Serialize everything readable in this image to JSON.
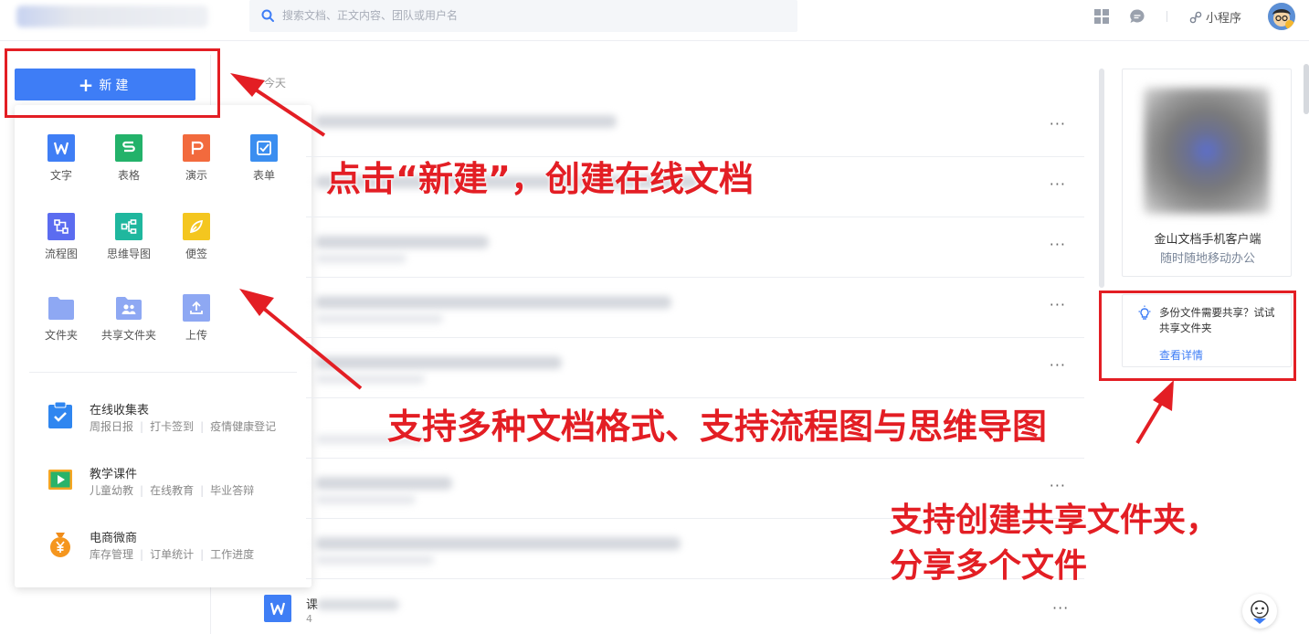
{
  "topbar": {
    "search_placeholder": "搜索文档、正文内容、团队或用户名",
    "mini_program": "小程序"
  },
  "new_button": {
    "plus": "+",
    "label": "新建"
  },
  "create_menu": {
    "types": [
      {
        "label": "文字",
        "color": "#3f7ef5",
        "icon": "word-doc-icon"
      },
      {
        "label": "表格",
        "color": "#23b26a",
        "icon": "spreadsheet-icon"
      },
      {
        "label": "演示",
        "color": "#f26a3d",
        "icon": "presentation-icon"
      },
      {
        "label": "表单",
        "color": "#3b8ef0",
        "icon": "form-icon"
      },
      {
        "label": "流程图",
        "color": "#5b6cf0",
        "icon": "flowchart-icon"
      },
      {
        "label": "思维导图",
        "color": "#1fb79e",
        "icon": "mindmap-icon"
      },
      {
        "label": "便签",
        "color": "#f4c61f",
        "icon": "note-icon"
      },
      {
        "label": "文件夹",
        "color": "#8ea8f3",
        "icon": "folder-icon"
      },
      {
        "label": "共享文件夹",
        "color": "#8ea8f3",
        "icon": "shared-folder-icon"
      },
      {
        "label": "上传",
        "color": "#8ea8f3",
        "icon": "upload-icon"
      }
    ],
    "templates": [
      {
        "title": "在线收集表",
        "links": [
          "周报日报",
          "打卡签到",
          "疫情健康登记"
        ],
        "icon": "clipboard-check-icon"
      },
      {
        "title": "教学课件",
        "links": [
          "儿童幼教",
          "在线教育",
          "毕业答辩"
        ],
        "icon": "play-board-icon"
      },
      {
        "title": "电商微商",
        "links": [
          "库存管理",
          "订单统计",
          "工作进度"
        ],
        "icon": "money-bag-icon"
      }
    ]
  },
  "file_list": {
    "section_label": "今天",
    "more_label": "···",
    "last_row_prefix": "课",
    "last_row_sub": "4"
  },
  "right_panel": {
    "app_title": "金山文档手机客户端",
    "app_subtitle": "随时随地移动办公",
    "tip_text": "多份文件需要共享？试试共享文件夹",
    "tip_link": "查看详情"
  },
  "annotations": {
    "note1": "点击“新建”，创建在线文档",
    "note2": "支持多种文档格式、支持流程图与思维导图",
    "note3_line1": "支持创建共享文件夹，",
    "note3_line2": "分享多个文件",
    "color": "#e31e24"
  }
}
